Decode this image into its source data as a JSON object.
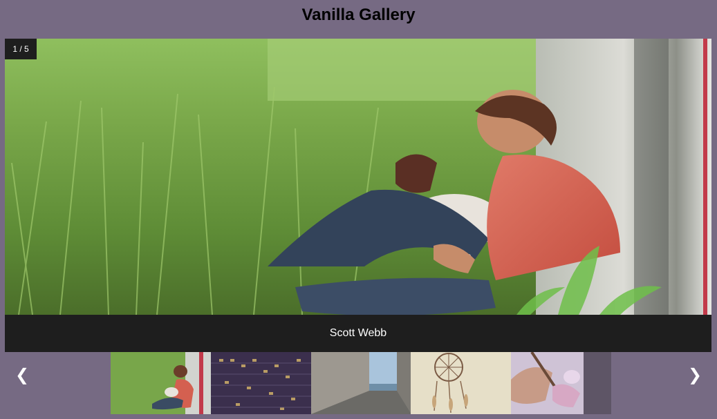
{
  "gallery": {
    "title": "Vanilla Gallery",
    "counter": "1 / 5",
    "caption": "Scott Webb",
    "prev_label": "❮",
    "next_label": "❯",
    "thumbnails": [
      {
        "subject": "man-with-dog-in-grass"
      },
      {
        "subject": "apartment-building-night"
      },
      {
        "subject": "alley-to-sea"
      },
      {
        "subject": "dreamcatcher"
      },
      {
        "subject": "hands-holding-instrument"
      }
    ]
  },
  "colors": {
    "background": "#766a83",
    "panel": "#1e1e1e",
    "text_light": "#ffffff"
  }
}
